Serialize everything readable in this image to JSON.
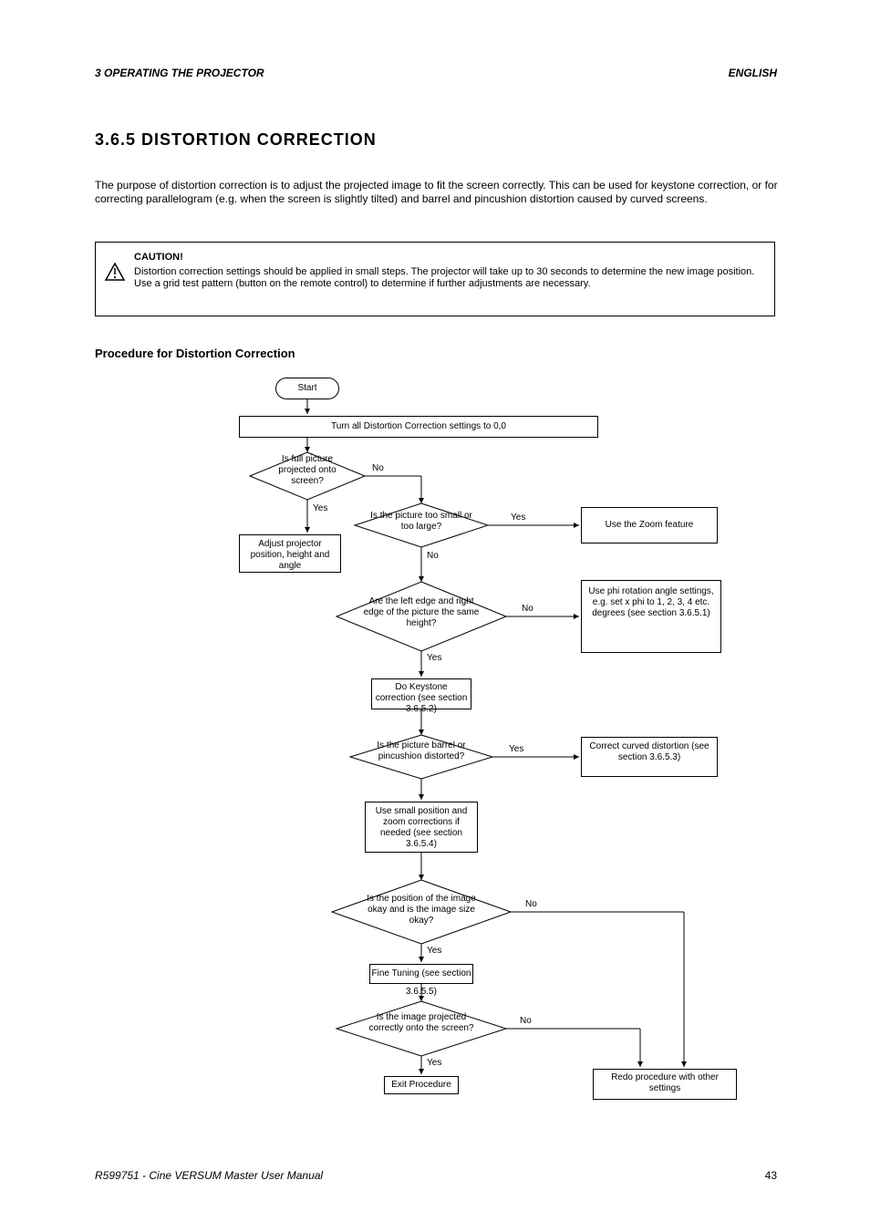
{
  "header": {
    "left": "3 OPERATING THE PROJECTOR",
    "right": "ENGLISH"
  },
  "title": "3.6.5  DISTORTION CORRECTION",
  "intro": "The purpose of distortion correction is to adjust the projected image to fit the screen correctly. This can be used for keystone correction, or for correcting parallelogram (e.g. when the screen is slightly tilted) and barrel and pincushion distortion caused by curved screens.",
  "warning": {
    "title": "CAUTION!",
    "text": "Distortion correction settings should be applied in small steps. The projector will take up to 30 seconds to determine the new image position. Use a grid test pattern (button on the remote control) to determine if further adjustments are necessary."
  },
  "procHeading": "Procedure for Distortion Correction",
  "steps": {
    "start": "Start",
    "s1": "Turn all Distortion Correction settings to 0,0",
    "d1": "Is full picture projected onto screen?",
    "d1_yes": "Yes",
    "d1_no": "No",
    "r1": "Adjust projector position, height and angle",
    "d2": "Is the picture too small or too large?",
    "d2_yesLabel": "Yes",
    "d2_noLabel": "No",
    "r2": "Use the Zoom feature",
    "d3": "Are the left edge and right edge of the picture the same height?",
    "d3_yesLabel": "Yes",
    "d3_noLabel": "No",
    "r3": "Use phi rotation angle settings, e.g. set x phi to 1, 2, 3, 4 etc. degrees (see section 3.6.5.1)",
    "s2": "Do Keystone correction (see section 3.6.5.2)",
    "d4": "Is the picture barrel or pincushion distorted?",
    "d4_yesLabel": "Yes",
    "r4": "Correct curved distortion (see section 3.6.5.3)",
    "s3": "Use small position and zoom corrections if needed (see section 3.6.5.4)",
    "d5": "Is the position of the image okay and is the image size okay?",
    "d5_yesLabel": "Yes",
    "d5_noLabel": "No",
    "s4": "Fine Tuning (see section 3.6.5.5)",
    "d6": "Is the image projected correctly onto the screen?",
    "d6_yesLabel": "Yes",
    "d6_noLabel": "No",
    "end": "Exit Procedure",
    "redo": "Redo procedure with other settings"
  },
  "footer": {
    "left": "R599751 - Cine VERSUM Master User Manual",
    "right": "43"
  }
}
